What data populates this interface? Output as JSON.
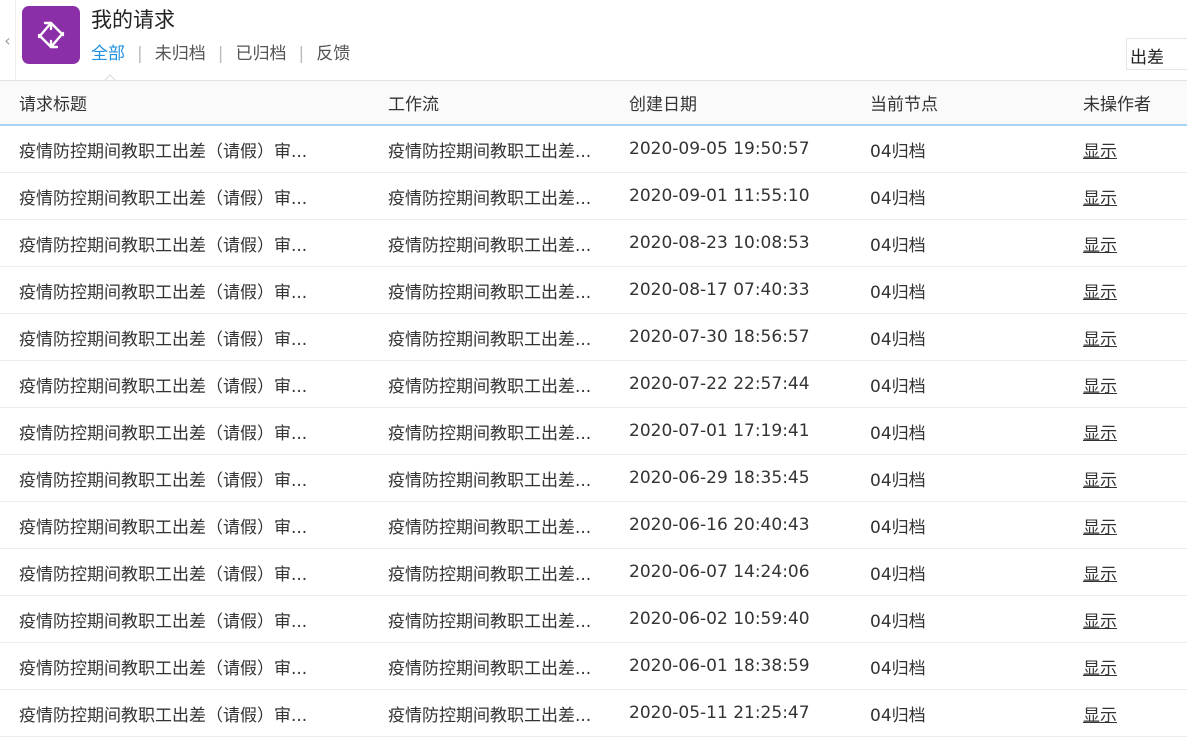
{
  "header": {
    "title": "我的请求",
    "tabs": [
      {
        "label": "全部",
        "active": true
      },
      {
        "label": "未归档",
        "active": false
      },
      {
        "label": "已归档",
        "active": false
      },
      {
        "label": "反馈",
        "active": false
      }
    ],
    "separator": "|",
    "search_value": "出差",
    "accent_color": "#1f8fe0",
    "logo_color": "#8a2fa8"
  },
  "table": {
    "columns": [
      "请求标题",
      "工作流",
      "创建日期",
      "当前节点",
      "未操作者"
    ],
    "rows": [
      {
        "title": "疫情防控期间教职工出差（请假）审...",
        "workflow": "疫情防控期间教职工出差...",
        "date": "2020-09-05 19:50:57",
        "node": "04归档",
        "action": "显示"
      },
      {
        "title": "疫情防控期间教职工出差（请假）审...",
        "workflow": "疫情防控期间教职工出差...",
        "date": "2020-09-01 11:55:10",
        "node": "04归档",
        "action": "显示"
      },
      {
        "title": "疫情防控期间教职工出差（请假）审...",
        "workflow": "疫情防控期间教职工出差...",
        "date": "2020-08-23 10:08:53",
        "node": "04归档",
        "action": "显示"
      },
      {
        "title": "疫情防控期间教职工出差（请假）审...",
        "workflow": "疫情防控期间教职工出差...",
        "date": "2020-08-17 07:40:33",
        "node": "04归档",
        "action": "显示"
      },
      {
        "title": "疫情防控期间教职工出差（请假）审...",
        "workflow": "疫情防控期间教职工出差...",
        "date": "2020-07-30 18:56:57",
        "node": "04归档",
        "action": "显示"
      },
      {
        "title": "疫情防控期间教职工出差（请假）审...",
        "workflow": "疫情防控期间教职工出差...",
        "date": "2020-07-22 22:57:44",
        "node": "04归档",
        "action": "显示"
      },
      {
        "title": "疫情防控期间教职工出差（请假）审...",
        "workflow": "疫情防控期间教职工出差...",
        "date": "2020-07-01 17:19:41",
        "node": "04归档",
        "action": "显示"
      },
      {
        "title": "疫情防控期间教职工出差（请假）审...",
        "workflow": "疫情防控期间教职工出差...",
        "date": "2020-06-29 18:35:45",
        "node": "04归档",
        "action": "显示"
      },
      {
        "title": "疫情防控期间教职工出差（请假）审...",
        "workflow": "疫情防控期间教职工出差...",
        "date": "2020-06-16 20:40:43",
        "node": "04归档",
        "action": "显示"
      },
      {
        "title": "疫情防控期间教职工出差（请假）审...",
        "workflow": "疫情防控期间教职工出差...",
        "date": "2020-06-07 14:24:06",
        "node": "04归档",
        "action": "显示"
      },
      {
        "title": "疫情防控期间教职工出差（请假）审...",
        "workflow": "疫情防控期间教职工出差...",
        "date": "2020-06-02 10:59:40",
        "node": "04归档",
        "action": "显示"
      },
      {
        "title": "疫情防控期间教职工出差（请假）审...",
        "workflow": "疫情防控期间教职工出差...",
        "date": "2020-06-01 18:38:59",
        "node": "04归档",
        "action": "显示"
      },
      {
        "title": "疫情防控期间教职工出差（请假）审...",
        "workflow": "疫情防控期间教职工出差...",
        "date": "2020-05-11 21:25:47",
        "node": "04归档",
        "action": "显示"
      }
    ]
  }
}
